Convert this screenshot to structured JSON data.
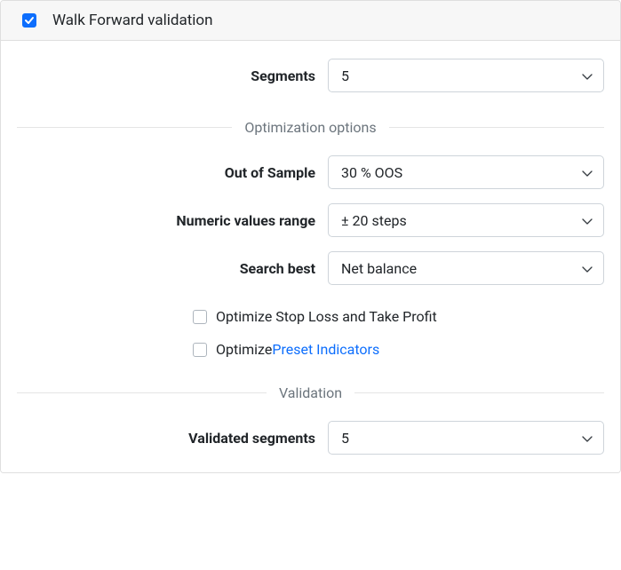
{
  "header": {
    "title": "Walk Forward validation",
    "checked": true
  },
  "segments": {
    "label": "Segments",
    "value": "5"
  },
  "sections": {
    "optimization": "Optimization options",
    "validation": "Validation"
  },
  "out_of_sample": {
    "label": "Out of Sample",
    "value": "30 % OOS"
  },
  "numeric_range": {
    "label": "Numeric values range",
    "value": "± 20 steps"
  },
  "search_best": {
    "label": "Search best",
    "value": "Net balance"
  },
  "opt_sltp": {
    "label": "Optimize Stop Loss and Take Profit",
    "checked": false
  },
  "opt_preset": {
    "prefix": "Optimize ",
    "link": "Preset Indicators",
    "checked": false
  },
  "validated_segments": {
    "label": "Validated segments",
    "value": "5"
  }
}
